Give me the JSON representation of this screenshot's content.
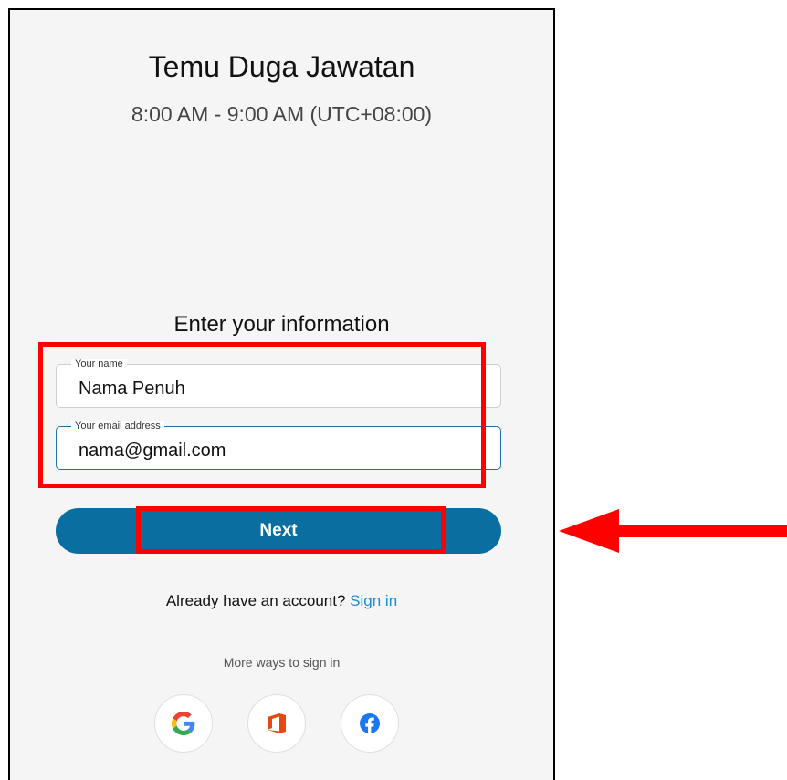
{
  "meeting": {
    "title": "Temu Duga Jawatan",
    "time": "8:00 AM - 9:00 AM (UTC+08:00)"
  },
  "form": {
    "heading": "Enter your information",
    "name_label": "Your name",
    "name_value": "Nama Penuh",
    "email_label": "Your email address",
    "email_value": "nama@gmail.com",
    "next_label": "Next"
  },
  "account": {
    "prompt": "Already have an account?",
    "signin_label": "Sign in"
  },
  "more_ways": "More ways to sign in",
  "social_icons": [
    "google-icon",
    "office-icon",
    "facebook-icon"
  ],
  "colors": {
    "accent": "#0a6fa0",
    "link": "#1a8cd8",
    "annotation": "#ff0000"
  }
}
